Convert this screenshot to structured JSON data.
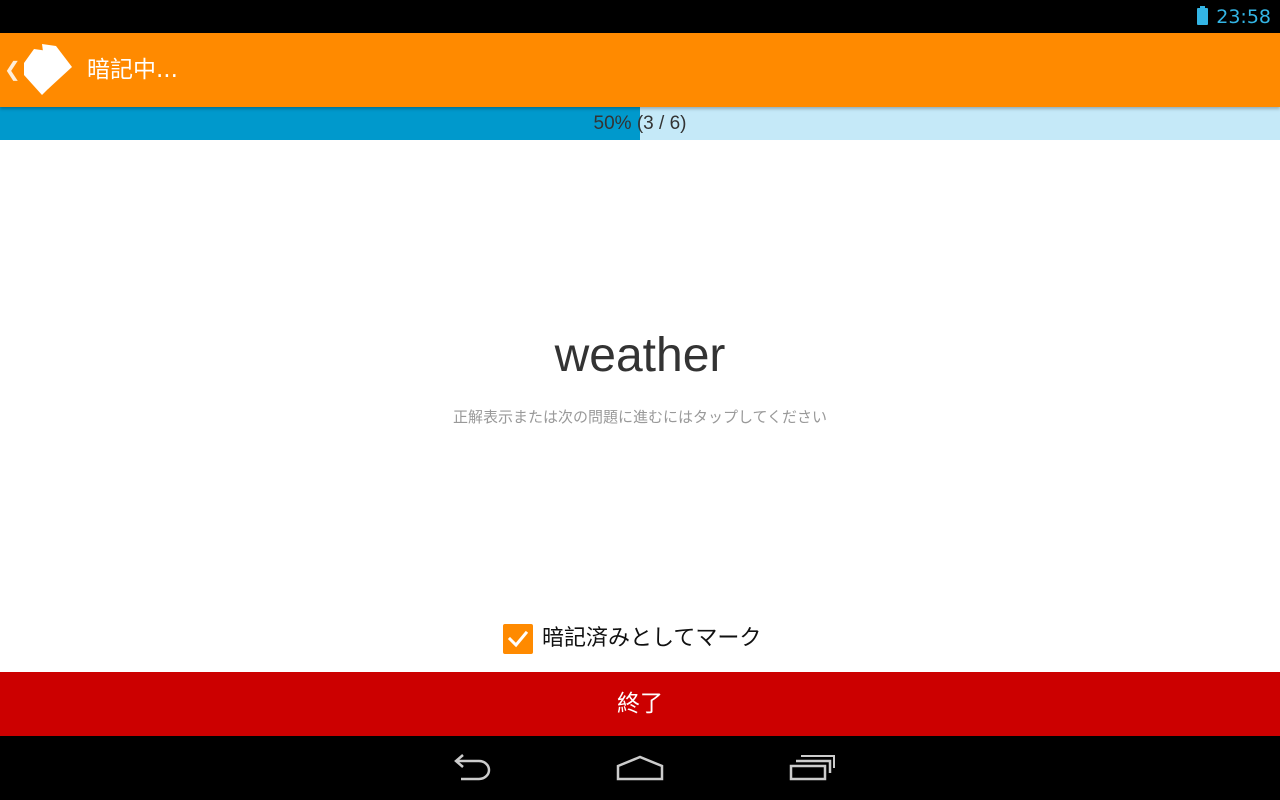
{
  "status_bar": {
    "time": "23:58",
    "battery_icon": "battery-full-icon",
    "clock_color": "#33b5e5"
  },
  "action_bar": {
    "title": "暗記中...",
    "up_icon": "chevron-left-icon",
    "app_icon": "tag-icon",
    "background_color": "#ff8a00"
  },
  "progress": {
    "label": "50% (3 / 6)",
    "percent": 50,
    "fill_color": "#0099cc",
    "track_color": "#c5e9f8"
  },
  "card": {
    "word": "weather",
    "hint": "正解表示または次の問題に進むにはタップしてください"
  },
  "mark": {
    "label": "暗記済みとしてマーク",
    "checked": true,
    "checkbox_color": "#ff8a00"
  },
  "finish_button": {
    "label": "終了",
    "color": "#cc0000"
  },
  "navigation": {
    "back_icon": "back-arrow-icon",
    "home_icon": "home-icon",
    "recents_icon": "recent-apps-icon"
  }
}
